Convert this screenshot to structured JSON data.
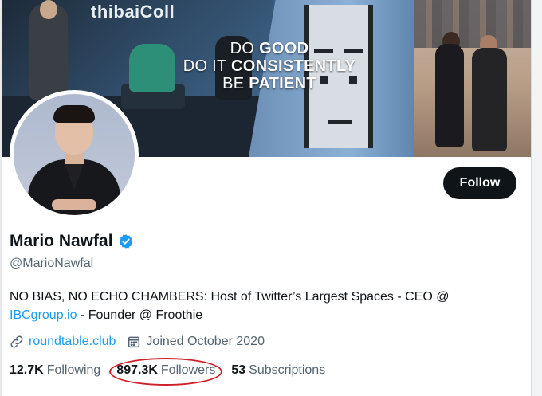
{
  "banner": {
    "logo_text": "thibaiColl",
    "quote_lines": [
      {
        "pre": "DO ",
        "bold": "GOOD"
      },
      {
        "pre": "DO IT ",
        "bold": "CONSISTENTLY"
      },
      {
        "pre": "BE ",
        "bold": "PATIENT"
      }
    ]
  },
  "profile": {
    "display_name": "Mario Nawfal",
    "handle": "@MarioNawfal",
    "verified": true,
    "bio_line1": "NO BIAS, NO ECHO CHAMBERS: Host of Twitter’s Largest Spaces - CEO @",
    "bio_link": "IBCgroup.io",
    "bio_line2_rest": " - Founder @ Froothie",
    "website": "roundtable.club",
    "joined": "Joined October 2020"
  },
  "actions": {
    "follow_label": "Follow"
  },
  "stats": {
    "following_count": "12.7K",
    "following_label": "Following",
    "followers_count": "897.3K",
    "followers_label": "Followers",
    "subscriptions_count": "53",
    "subscriptions_label": "Subscriptions"
  },
  "colors": {
    "accent": "#1d9bf0",
    "highlight": "#d0212b",
    "text_primary": "#0f1419",
    "text_secondary": "#536471"
  },
  "icons": {
    "verified": "verified-badge-icon",
    "website": "link-icon",
    "joined": "calendar-icon"
  }
}
